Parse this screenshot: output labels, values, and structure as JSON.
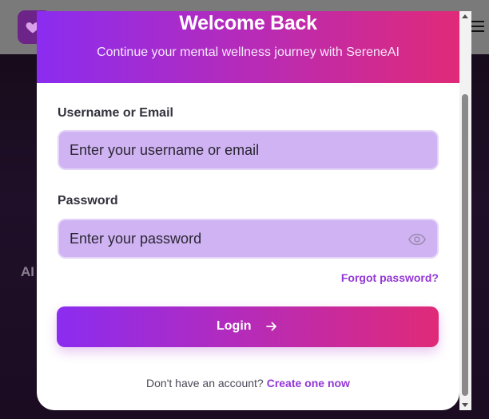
{
  "modal": {
    "title": "Welcome Back",
    "subtitle": "Continue your mental wellness journey with SereneAI"
  },
  "form": {
    "username_label": "Username or Email",
    "username_placeholder": "Enter your username or email",
    "password_label": "Password",
    "password_placeholder": "Enter your password",
    "forgot_password": "Forgot password?",
    "login_label": "Login"
  },
  "footer": {
    "prompt": "Don't have an account?",
    "link": "Create one now"
  },
  "background": {
    "left_text": "AI",
    "right_text": "."
  },
  "colors": {
    "accent_start": "#8b2cf0",
    "accent_end": "#e02a78",
    "link": "#9336d6",
    "field_bg": "#d0b3f3"
  },
  "icons": {
    "logo": "heart-icon",
    "menu": "hamburger-icon",
    "password_toggle": "eye-icon",
    "login_arrow": "arrow-right-icon"
  }
}
